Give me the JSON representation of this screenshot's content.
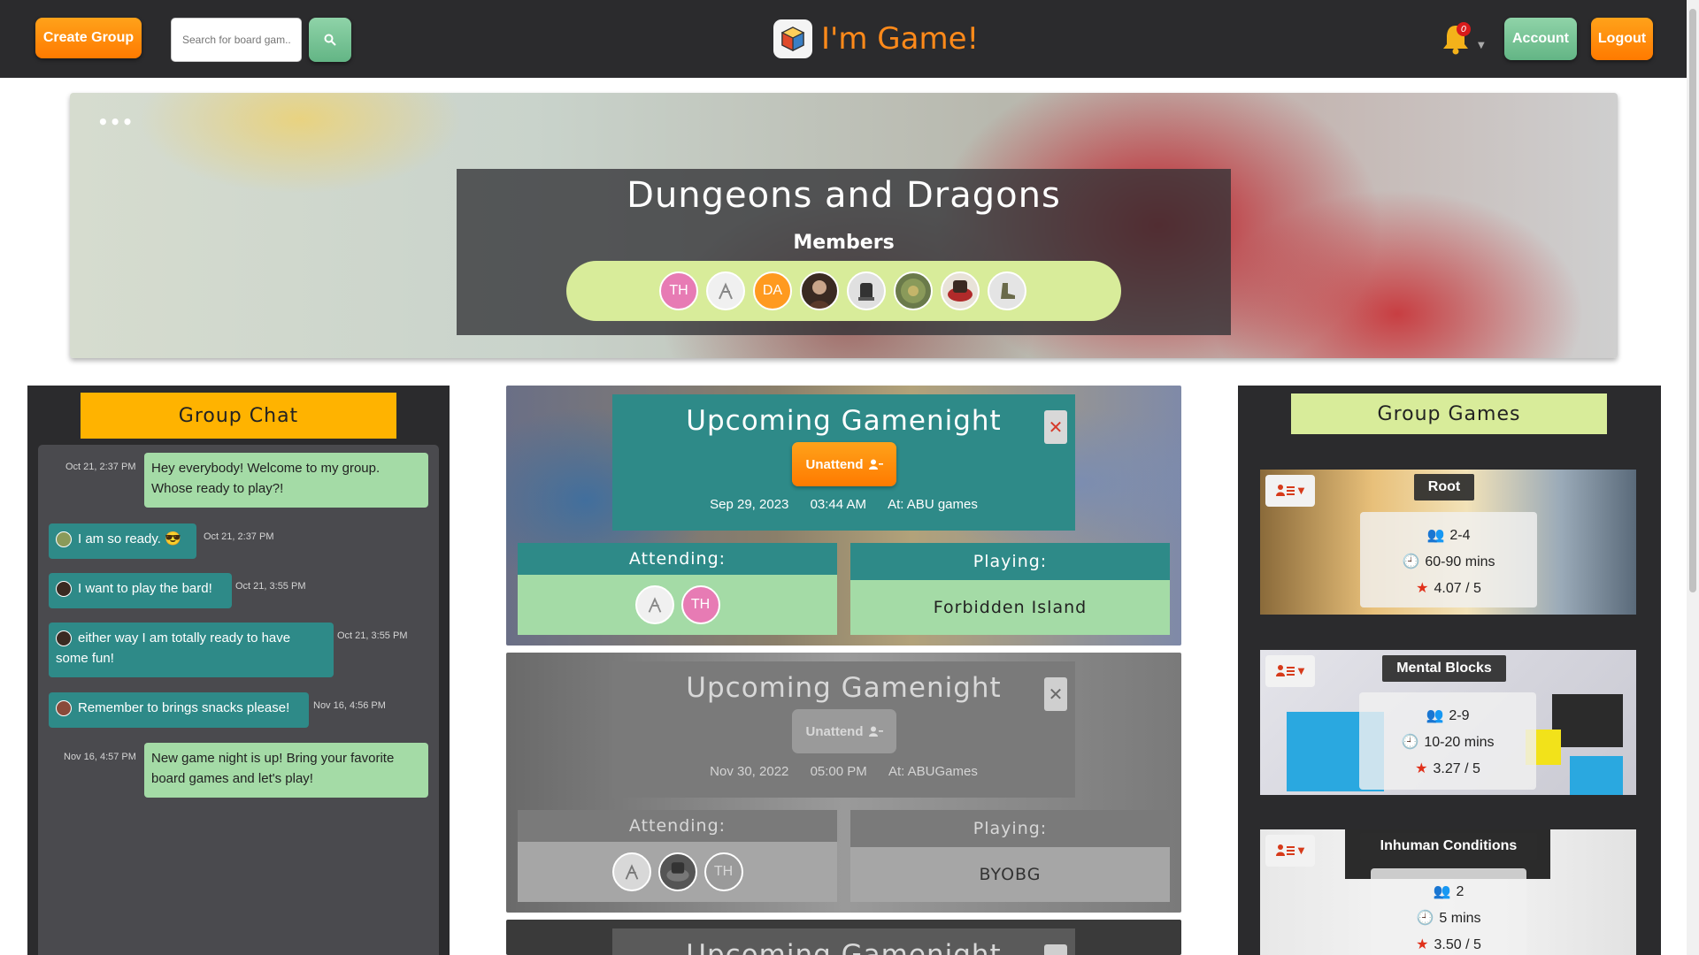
{
  "nav": {
    "create_group": "Create Group",
    "search_placeholder": "Search for board gam...",
    "logo_text": "I'm Game!",
    "notification_count": "0",
    "account": "Account",
    "logout": "Logout"
  },
  "banner": {
    "menu_dots": "•••",
    "group_name": "Dungeons and Dragons",
    "members_label": "Members",
    "members": [
      {
        "initials": "TH",
        "color": "#e77bb4"
      },
      {
        "initials": "",
        "color": "#f0f0f0"
      },
      {
        "initials": "DA",
        "color": "#ff9a1f"
      },
      {
        "initials": "",
        "color": "#3a2a22"
      },
      {
        "initials": "",
        "color": "#4a4a3e"
      },
      {
        "initials": "",
        "color": "#6a7a4a"
      },
      {
        "initials": "",
        "color": "#5a4a3a"
      },
      {
        "initials": "",
        "color": "#cfcfcf"
      }
    ]
  },
  "chat": {
    "title": "Group Chat",
    "messages": [
      {
        "time": "Oct 21, 2:37 PM",
        "line1": "Hey everybody! Welcome to my group.",
        "line2": "Whose ready to play?!"
      },
      {
        "time": "Oct 21, 2:37 PM",
        "line1": "I am so ready. 😎"
      },
      {
        "time": "Oct 21, 3:55 PM",
        "line1": "I want to play the bard!"
      },
      {
        "time": "Oct 21, 3:55 PM",
        "line1": "either way I am totally ready to have",
        "line2": "some fun!"
      },
      {
        "time": "Nov 16, 4:56 PM",
        "line1": "Remember to brings snacks please!"
      },
      {
        "time": "Nov 16, 4:57 PM",
        "line1": "New game night is up! Bring your favorite",
        "line2": "board games and let's play!"
      }
    ]
  },
  "gamenights": [
    {
      "title": "Upcoming Gamenight",
      "unattend": "Unattend",
      "date": "Sep 29, 2023",
      "time": "03:44 AM",
      "location": "At: ABU games",
      "attending_label": "Attending:",
      "attendees": [
        "",
        "TH"
      ],
      "playing_label": "Playing:",
      "playing": "Forbidden Island"
    },
    {
      "title": "Upcoming Gamenight",
      "unattend": "Unattend",
      "date": "Nov 30, 2022",
      "time": "05:00 PM",
      "location": "At: ABUGames",
      "attending_label": "Attending:",
      "attendees": [
        "",
        "",
        "TH"
      ],
      "playing_label": "Playing:",
      "playing": "BYOBG"
    },
    {
      "title": "Upcoming Gamenight"
    }
  ],
  "games": {
    "title": "Group Games",
    "list": [
      {
        "name": "Root",
        "players": "2-4",
        "duration": "60-90 mins",
        "rating": "4.07 / 5"
      },
      {
        "name": "Mental Blocks",
        "players": "2-9",
        "duration": "10-20 mins",
        "rating": "3.27 / 5"
      },
      {
        "name": "Inhuman Conditions",
        "players": "2",
        "duration": "5 mins",
        "rating": "3.50 / 5"
      }
    ]
  },
  "colors": {
    "orange": "#ff8a1a",
    "teal": "#2e8a88",
    "chat_green": "#a4dba6",
    "lime": "#d8ec9a",
    "panel_dark": "#2b2b2d"
  }
}
